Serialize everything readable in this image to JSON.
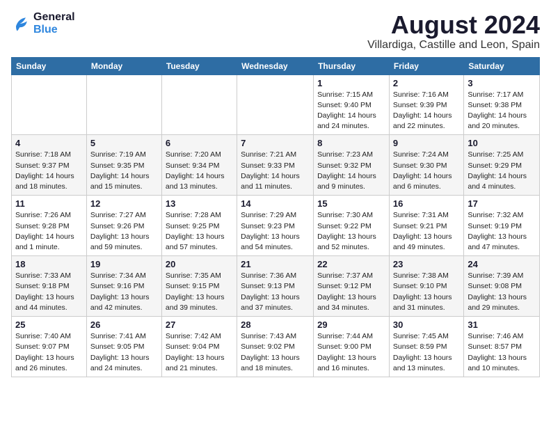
{
  "logo": {
    "line1": "General",
    "line2": "Blue"
  },
  "title": "August 2024",
  "location": "Villardiga, Castille and Leon, Spain",
  "days_of_week": [
    "Sunday",
    "Monday",
    "Tuesday",
    "Wednesday",
    "Thursday",
    "Friday",
    "Saturday"
  ],
  "weeks": [
    [
      {
        "day": "",
        "info": ""
      },
      {
        "day": "",
        "info": ""
      },
      {
        "day": "",
        "info": ""
      },
      {
        "day": "",
        "info": ""
      },
      {
        "day": "1",
        "info": "Sunrise: 7:15 AM\nSunset: 9:40 PM\nDaylight: 14 hours\nand 24 minutes."
      },
      {
        "day": "2",
        "info": "Sunrise: 7:16 AM\nSunset: 9:39 PM\nDaylight: 14 hours\nand 22 minutes."
      },
      {
        "day": "3",
        "info": "Sunrise: 7:17 AM\nSunset: 9:38 PM\nDaylight: 14 hours\nand 20 minutes."
      }
    ],
    [
      {
        "day": "4",
        "info": "Sunrise: 7:18 AM\nSunset: 9:37 PM\nDaylight: 14 hours\nand 18 minutes."
      },
      {
        "day": "5",
        "info": "Sunrise: 7:19 AM\nSunset: 9:35 PM\nDaylight: 14 hours\nand 15 minutes."
      },
      {
        "day": "6",
        "info": "Sunrise: 7:20 AM\nSunset: 9:34 PM\nDaylight: 14 hours\nand 13 minutes."
      },
      {
        "day": "7",
        "info": "Sunrise: 7:21 AM\nSunset: 9:33 PM\nDaylight: 14 hours\nand 11 minutes."
      },
      {
        "day": "8",
        "info": "Sunrise: 7:23 AM\nSunset: 9:32 PM\nDaylight: 14 hours\nand 9 minutes."
      },
      {
        "day": "9",
        "info": "Sunrise: 7:24 AM\nSunset: 9:30 PM\nDaylight: 14 hours\nand 6 minutes."
      },
      {
        "day": "10",
        "info": "Sunrise: 7:25 AM\nSunset: 9:29 PM\nDaylight: 14 hours\nand 4 minutes."
      }
    ],
    [
      {
        "day": "11",
        "info": "Sunrise: 7:26 AM\nSunset: 9:28 PM\nDaylight: 14 hours\nand 1 minute."
      },
      {
        "day": "12",
        "info": "Sunrise: 7:27 AM\nSunset: 9:26 PM\nDaylight: 13 hours\nand 59 minutes."
      },
      {
        "day": "13",
        "info": "Sunrise: 7:28 AM\nSunset: 9:25 PM\nDaylight: 13 hours\nand 57 minutes."
      },
      {
        "day": "14",
        "info": "Sunrise: 7:29 AM\nSunset: 9:23 PM\nDaylight: 13 hours\nand 54 minutes."
      },
      {
        "day": "15",
        "info": "Sunrise: 7:30 AM\nSunset: 9:22 PM\nDaylight: 13 hours\nand 52 minutes."
      },
      {
        "day": "16",
        "info": "Sunrise: 7:31 AM\nSunset: 9:21 PM\nDaylight: 13 hours\nand 49 minutes."
      },
      {
        "day": "17",
        "info": "Sunrise: 7:32 AM\nSunset: 9:19 PM\nDaylight: 13 hours\nand 47 minutes."
      }
    ],
    [
      {
        "day": "18",
        "info": "Sunrise: 7:33 AM\nSunset: 9:18 PM\nDaylight: 13 hours\nand 44 minutes."
      },
      {
        "day": "19",
        "info": "Sunrise: 7:34 AM\nSunset: 9:16 PM\nDaylight: 13 hours\nand 42 minutes."
      },
      {
        "day": "20",
        "info": "Sunrise: 7:35 AM\nSunset: 9:15 PM\nDaylight: 13 hours\nand 39 minutes."
      },
      {
        "day": "21",
        "info": "Sunrise: 7:36 AM\nSunset: 9:13 PM\nDaylight: 13 hours\nand 37 minutes."
      },
      {
        "day": "22",
        "info": "Sunrise: 7:37 AM\nSunset: 9:12 PM\nDaylight: 13 hours\nand 34 minutes."
      },
      {
        "day": "23",
        "info": "Sunrise: 7:38 AM\nSunset: 9:10 PM\nDaylight: 13 hours\nand 31 minutes."
      },
      {
        "day": "24",
        "info": "Sunrise: 7:39 AM\nSunset: 9:08 PM\nDaylight: 13 hours\nand 29 minutes."
      }
    ],
    [
      {
        "day": "25",
        "info": "Sunrise: 7:40 AM\nSunset: 9:07 PM\nDaylight: 13 hours\nand 26 minutes."
      },
      {
        "day": "26",
        "info": "Sunrise: 7:41 AM\nSunset: 9:05 PM\nDaylight: 13 hours\nand 24 minutes."
      },
      {
        "day": "27",
        "info": "Sunrise: 7:42 AM\nSunset: 9:04 PM\nDaylight: 13 hours\nand 21 minutes."
      },
      {
        "day": "28",
        "info": "Sunrise: 7:43 AM\nSunset: 9:02 PM\nDaylight: 13 hours\nand 18 minutes."
      },
      {
        "day": "29",
        "info": "Sunrise: 7:44 AM\nSunset: 9:00 PM\nDaylight: 13 hours\nand 16 minutes."
      },
      {
        "day": "30",
        "info": "Sunrise: 7:45 AM\nSunset: 8:59 PM\nDaylight: 13 hours\nand 13 minutes."
      },
      {
        "day": "31",
        "info": "Sunrise: 7:46 AM\nSunset: 8:57 PM\nDaylight: 13 hours\nand 10 minutes."
      }
    ]
  ]
}
